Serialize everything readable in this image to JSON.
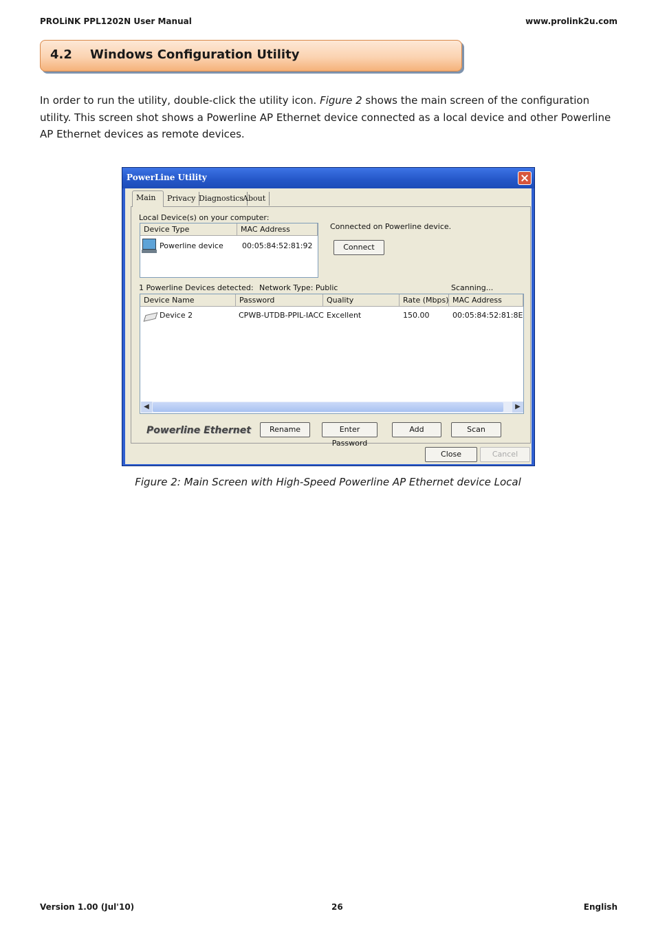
{
  "header": {
    "left": "PROLiNK PPL1202N User Manual",
    "right": "www.prolink2u.com"
  },
  "section": {
    "number": "4.2",
    "title": "Windows Configuration Utility"
  },
  "paragraph": {
    "part1": "In order to run the utility, double-click the utility icon. ",
    "figure_ref": "Figure 2",
    "part2": " shows the main screen of the configuration utility. This screen shot shows a Powerline AP Ethernet device connected as a local device and other Powerline AP Ethernet devices as remote devices."
  },
  "utility": {
    "title": "PowerLine Utility",
    "tabs": [
      "Main",
      "Privacy",
      "Diagnostics",
      "About"
    ],
    "local_label": "Local Device(s) on your computer:",
    "local_columns": [
      "Device Type",
      "MAC Address"
    ],
    "local_rows": [
      {
        "device_type": "Powerline device",
        "mac": "00:05:84:52:81:92"
      }
    ],
    "connected_text": "Connected on Powerline device.",
    "connect_button": "Connect",
    "detected_text": "1 Powerline Devices detected:",
    "network_type": "Network Type: Public",
    "scanning": "Scanning...",
    "remote_columns": [
      "Device Name",
      "Password",
      "Quality",
      "Rate (Mbps)",
      "MAC Address"
    ],
    "remote_rows": [
      {
        "name": "Device 2",
        "password": "CPWB-UTDB-PPIL-IACC",
        "quality": "Excellent",
        "rate": "150.00",
        "mac": "00:05:84:52:81:8E"
      }
    ],
    "brand": "Powerline Ethernet",
    "buttons": {
      "rename": "Rename",
      "enter_password": "Enter Password",
      "add": "Add",
      "scan": "Scan",
      "close": "Close",
      "cancel": "Cancel"
    }
  },
  "caption": "Figure 2: Main Screen with High-Speed Powerline AP Ethernet device Local",
  "footer": {
    "left": "Version 1.00 (Jul'10)",
    "page": "26",
    "right": "English"
  }
}
